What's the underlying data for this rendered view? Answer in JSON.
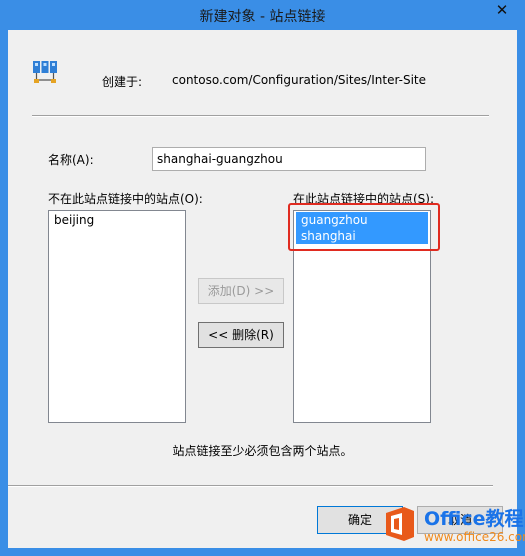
{
  "window": {
    "title": "新建对象 - 站点链接",
    "close_glyph": "✕"
  },
  "header": {
    "created_label": "创建于:",
    "created_value": "contoso.com/Configuration/Sites/Inter-Site"
  },
  "form": {
    "name_label": "名称(A):",
    "name_value": "shanghai-guangzhou"
  },
  "lists": {
    "available": {
      "label": "不在此站点链接中的站点(O):",
      "items": [
        "beijing"
      ]
    },
    "selected": {
      "label": "在此站点链接中的站点(S):",
      "items": [
        "guangzhou",
        "shanghai"
      ]
    }
  },
  "buttons": {
    "add": "添加(D) >>",
    "remove": "<< 删除(R)",
    "ok": "确定",
    "cancel": "取消"
  },
  "note": "站点链接至少必须包含两个站点。",
  "watermark": {
    "title": "Office教程网",
    "url": "www.office26.com"
  },
  "colors": {
    "titlebar": "#3a8ee6",
    "selection": "#3399ff",
    "highlight_box": "#e02b20"
  }
}
